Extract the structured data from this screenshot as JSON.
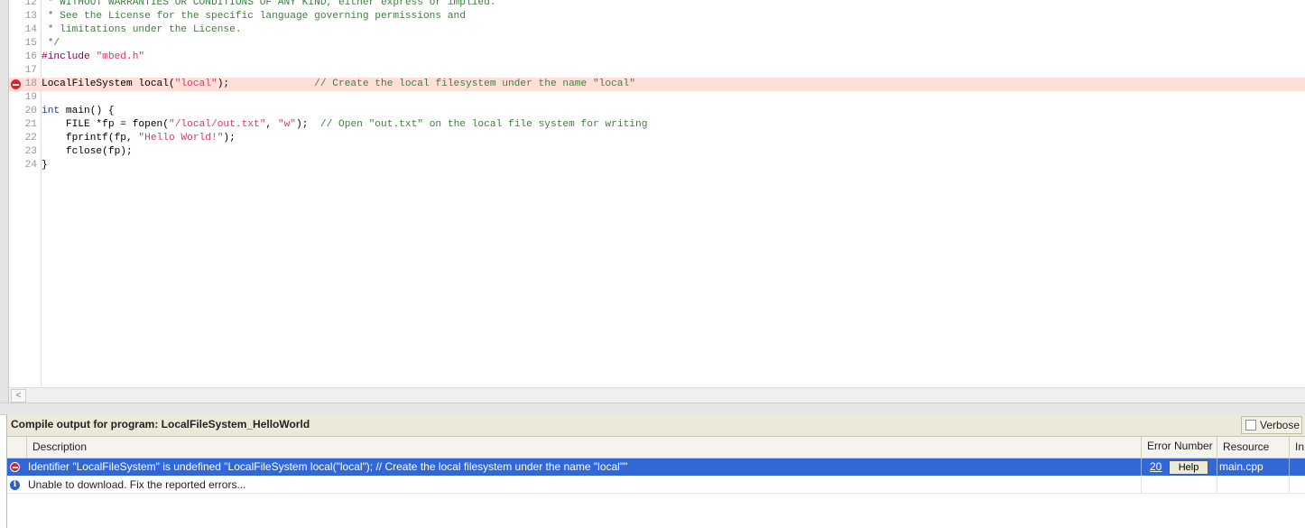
{
  "editor": {
    "lines": [
      {
        "n": "12",
        "parts": [
          {
            "t": " * WITHOUT WARRANTIES OR CONDITIONS OF ANY KIND, either express or implied.",
            "c": "comment"
          }
        ]
      },
      {
        "n": "13",
        "parts": [
          {
            "t": " * See the License for the specific language governing permissions and",
            "c": "comment"
          }
        ]
      },
      {
        "n": "14",
        "parts": [
          {
            "t": " * limitations under the License.",
            "c": "comment"
          }
        ]
      },
      {
        "n": "15",
        "parts": [
          {
            "t": " */",
            "c": "comment"
          }
        ]
      },
      {
        "n": "16",
        "parts": [
          {
            "t": "#include ",
            "c": "pre"
          },
          {
            "t": "\"mbed.h\"",
            "c": "str"
          }
        ]
      },
      {
        "n": "17",
        "parts": []
      },
      {
        "n": "18",
        "error": true,
        "parts": [
          {
            "t": "LocalFileSystem local(",
            "c": ""
          },
          {
            "t": "\"local\"",
            "c": "str"
          },
          {
            "t": ");              ",
            "c": ""
          },
          {
            "t": "// Create the local filesystem under the name \"local\"",
            "c": "comment"
          }
        ]
      },
      {
        "n": "19",
        "parts": []
      },
      {
        "n": "20",
        "parts": [
          {
            "t": "int",
            "c": "kw"
          },
          {
            "t": " main() {",
            "c": ""
          }
        ]
      },
      {
        "n": "21",
        "parts": [
          {
            "t": "    FILE *fp = fopen(",
            "c": ""
          },
          {
            "t": "\"/local/out.txt\"",
            "c": "str"
          },
          {
            "t": ", ",
            "c": ""
          },
          {
            "t": "\"w\"",
            "c": "str"
          },
          {
            "t": ");  ",
            "c": ""
          },
          {
            "t": "// Open \"out.txt\" on the local file system for writing",
            "c": "comment"
          }
        ]
      },
      {
        "n": "22",
        "parts": [
          {
            "t": "    fprintf(fp, ",
            "c": ""
          },
          {
            "t": "\"Hello World!\"",
            "c": "str"
          },
          {
            "t": ");",
            "c": ""
          }
        ]
      },
      {
        "n": "23",
        "parts": [
          {
            "t": "    fclose(fp);",
            "c": ""
          }
        ]
      },
      {
        "n": "24",
        "parts": [
          {
            "t": "}",
            "c": ""
          }
        ]
      }
    ],
    "scroll_left_glyph": "<"
  },
  "compile_panel": {
    "title": "Compile output for program: LocalFileSystem_HelloWorld",
    "verbose_label": "Verbose",
    "verbose_checked": false,
    "columns": {
      "description": "Description",
      "error_number": "Error Number",
      "resource": "Resource",
      "in_folder": "In Folder"
    },
    "rows": [
      {
        "type": "error",
        "icon": "error-icon",
        "description": "Identifier \"LocalFileSystem\" is undefined \"LocalFileSystem local(\"local\"); // Create the local filesystem under the name \"local\"\"",
        "error_number": "20",
        "help_label": "Help",
        "resource": "main.cpp",
        "selected": true
      },
      {
        "type": "info",
        "icon": "info-icon",
        "description": "Unable to download. Fix the reported errors...",
        "error_number": "",
        "resource": ""
      }
    ]
  },
  "colors": {
    "selection": "#3168d5",
    "error_line": "#ffe0d8",
    "error_icon": "#d8242c",
    "info_icon": "#2a62c9",
    "comment": "#3f7f3f",
    "string": "#d23c6c",
    "preprocessor": "#7f0055",
    "keyword": "#1a3fb0"
  }
}
